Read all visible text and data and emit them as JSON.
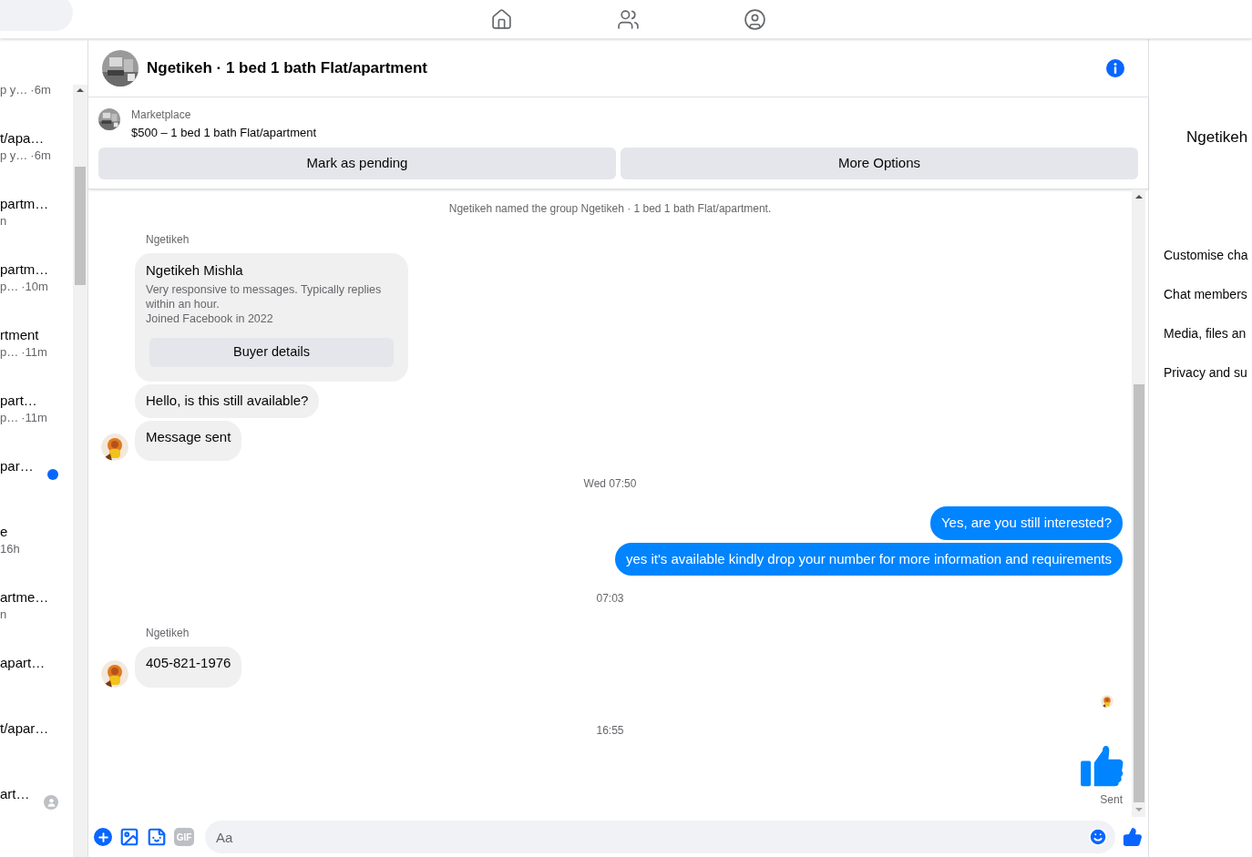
{
  "search": {
    "kind": "field"
  },
  "sidebar": {
    "items": [
      {
        "subtitle": "p y…",
        "time": "·6m",
        "unread": false,
        "seen_by_avatar": false
      },
      {
        "title": "t/apa…",
        "subtitle": "p y…",
        "time": "·6m",
        "unread": false,
        "seen_by_avatar": false
      },
      {
        "title": "partm…",
        "subtitle": "n",
        "unread": false,
        "seen_by_avatar": false
      },
      {
        "title": "partm…",
        "subtitle": "p…",
        "time": "·10m",
        "unread": false,
        "seen_by_avatar": false
      },
      {
        "title": "rtment",
        "subtitle": "p…",
        "time": "·11m",
        "unread": false,
        "seen_by_avatar": false
      },
      {
        "title": "part…",
        "subtitle": "p…",
        "time": "·11m",
        "unread": false,
        "seen_by_avatar": false
      },
      {
        "title": "par…",
        "unread": true,
        "seen_by_avatar": false
      },
      {
        "title": "e",
        "time": "16h",
        "unread": false,
        "seen_by_avatar": false
      },
      {
        "title": "artme…",
        "subtitle": "n",
        "unread": false,
        "seen_by_avatar": false
      },
      {
        "title": "apart…",
        "unread": false,
        "seen_by_avatar": false
      },
      {
        "title": "t/apar…",
        "unread": false,
        "seen_by_avatar": false
      },
      {
        "title": "art…",
        "unread": false,
        "seen_by_avatar": true
      }
    ]
  },
  "chat": {
    "title": "Ngetikeh · 1 bed 1 bath Flat/apartment",
    "listing": {
      "label": "Marketplace",
      "summary": "$500 – 1 bed 1 bath Flat/apartment"
    },
    "actions": [
      "Mark as pending",
      "More Options"
    ],
    "messages": [
      {
        "kind": "system",
        "text": "Ngetikeh named the group Ngetikeh · 1 bed 1 bath Flat/apartment."
      },
      {
        "kind": "sender",
        "text": "Ngetikeh"
      },
      {
        "kind": "card",
        "name": "Ngetikeh Mishla",
        "lines": [
          "Very responsive to messages. Typically replies within an hour.",
          "Joined Facebook in 2022"
        ],
        "button": "Buyer details"
      },
      {
        "kind": "incoming",
        "text": "Hello, is this still available?",
        "avatar": false
      },
      {
        "kind": "incoming",
        "text": "Message sent",
        "avatar": true
      },
      {
        "kind": "time",
        "text": "Wed 07:50"
      },
      {
        "kind": "outgoing",
        "text": "Yes, are you still interested?"
      },
      {
        "kind": "outgoing",
        "text": "yes it's available kindly drop your number for more information and requirements"
      },
      {
        "kind": "time",
        "text": "07:03"
      },
      {
        "kind": "sender",
        "text": "Ngetikeh"
      },
      {
        "kind": "incoming",
        "text": "405-821-1976",
        "avatar": true
      },
      {
        "kind": "seen"
      },
      {
        "kind": "time",
        "text": "16:55"
      },
      {
        "kind": "like",
        "status": "Sent"
      }
    ],
    "composer": {
      "gif": "GIF",
      "placeholder": "Aa"
    }
  },
  "details": {
    "name": "Ngetikeh",
    "items": [
      "Customise cha",
      "Chat members",
      "Media, files an",
      "Privacy and su"
    ]
  }
}
